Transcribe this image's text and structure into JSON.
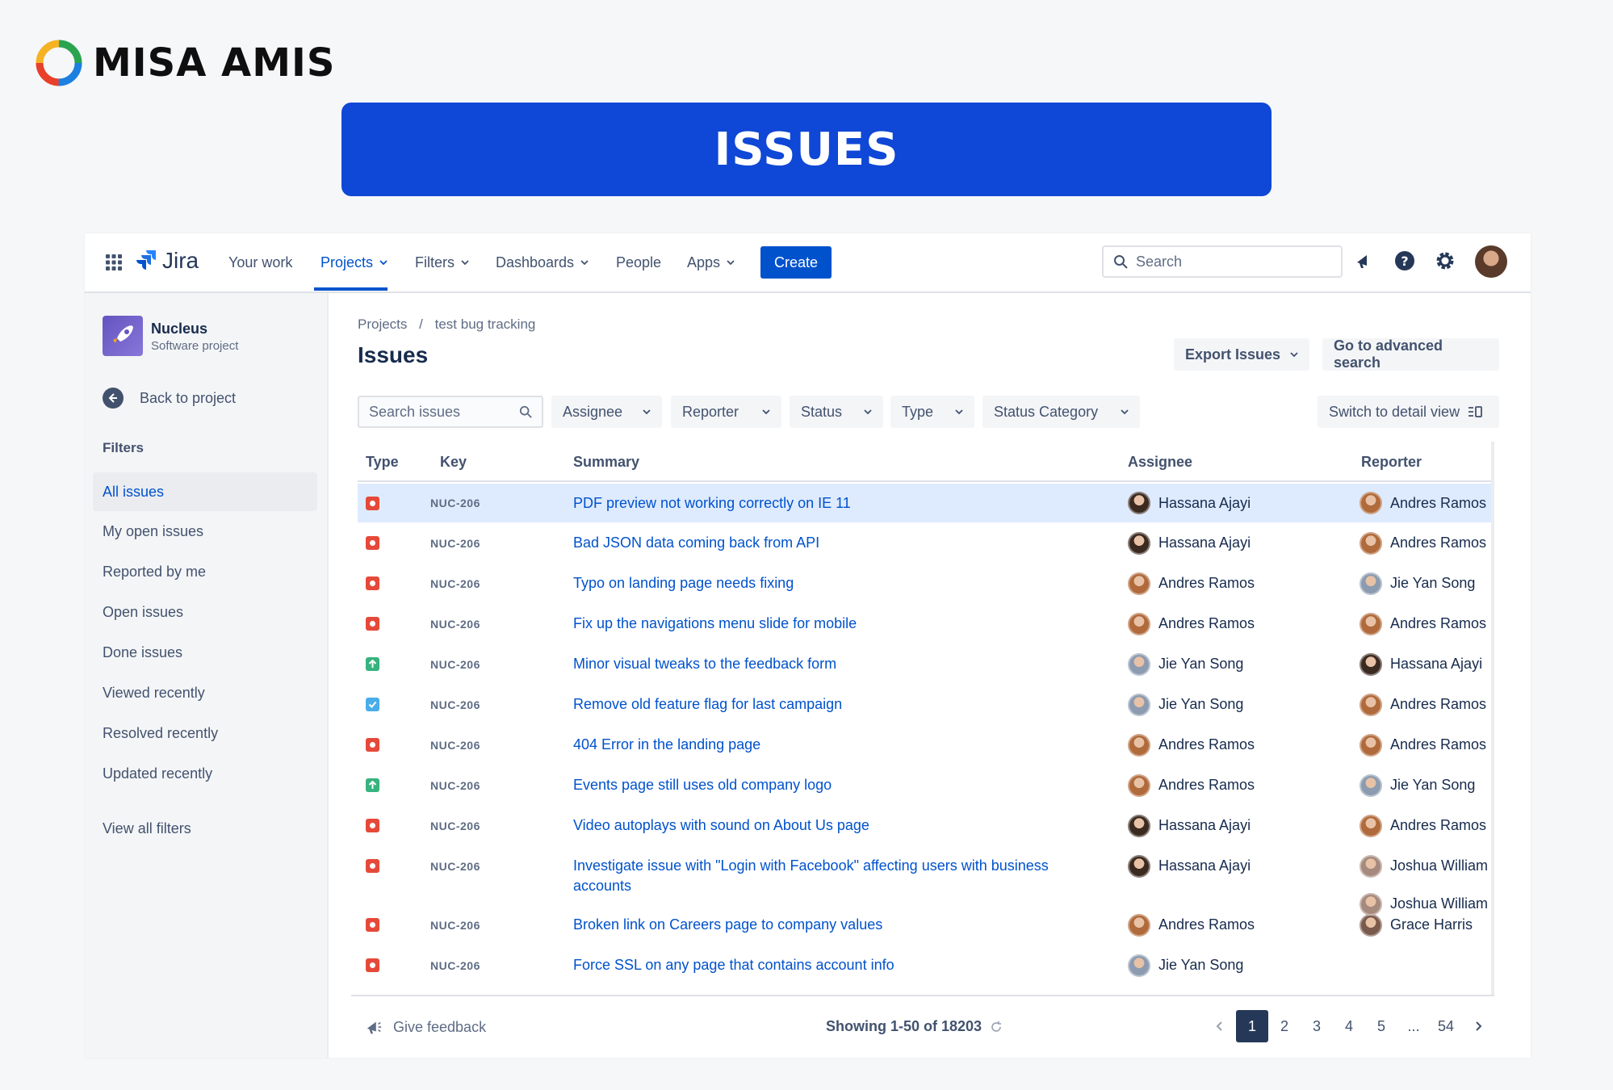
{
  "brand": {
    "name": "MISA AMIS"
  },
  "banner": {
    "title": "ISSUES"
  },
  "nav": {
    "app_name": "Jira",
    "items": [
      "Your work",
      "Projects",
      "Filters",
      "Dashboards",
      "People",
      "Apps"
    ],
    "create_label": "Create",
    "search_placeholder": "Search"
  },
  "sidebar": {
    "project_name": "Nucleus",
    "project_type": "Software project",
    "back_label": "Back to project",
    "filters_title": "Filters",
    "items": [
      "All issues",
      "My open issues",
      "Reported by me",
      "Open issues",
      "Done issues",
      "Viewed recently",
      "Resolved recently",
      "Updated recently"
    ],
    "view_all": "View all filters"
  },
  "main": {
    "breadcrumb": [
      "Projects",
      "/",
      "test bug tracking"
    ],
    "title": "Issues",
    "export_label": "Export Issues",
    "advanced_label": "Go to advanced search",
    "search_placeholder": "Search issues",
    "filters": [
      "Assignee",
      "Reporter",
      "Status",
      "Type",
      "Status Category"
    ],
    "detail_view_label": "Switch to detail view"
  },
  "table": {
    "headers": [
      "Type",
      "Key",
      "Summary",
      "Assignee",
      "Reporter"
    ],
    "rows": [
      {
        "type": "bug",
        "key": "NUC-206",
        "summary": "PDF preview not working correctly on IE 11",
        "assignee": "Hassana Ajayi",
        "reporter": "Andres Ramos"
      },
      {
        "type": "bug",
        "key": "NUC-206",
        "summary": "Bad JSON data coming back from API",
        "assignee": "Hassana Ajayi",
        "reporter": "Andres Ramos"
      },
      {
        "type": "bug",
        "key": "NUC-206",
        "summary": "Typo on landing page needs fixing",
        "assignee": "Andres Ramos",
        "reporter": "Jie Yan Song"
      },
      {
        "type": "bug",
        "key": "NUC-206",
        "summary": "Fix up the navigations menu slide for mobile",
        "assignee": "Andres Ramos",
        "reporter": "Andres Ramos"
      },
      {
        "type": "improvement",
        "key": "NUC-206",
        "summary": "Minor visual tweaks to the feedback form",
        "assignee": "Jie Yan Song",
        "reporter": "Hassana Ajayi"
      },
      {
        "type": "task",
        "key": "NUC-206",
        "summary": "Remove old feature flag for last campaign",
        "assignee": "Jie Yan Song",
        "reporter": "Andres Ramos"
      },
      {
        "type": "bug",
        "key": "NUC-206",
        "summary": "404 Error in the landing page",
        "assignee": "Andres Ramos",
        "reporter": "Andres Ramos"
      },
      {
        "type": "improvement",
        "key": "NUC-206",
        "summary": "Events page still uses old company logo",
        "assignee": "Andres Ramos",
        "reporter": "Jie Yan Song"
      },
      {
        "type": "bug",
        "key": "NUC-206",
        "summary": "Video autoplays with sound on About Us page",
        "assignee": "Hassana Ajayi",
        "reporter": "Andres Ramos"
      },
      {
        "type": "bug",
        "key": "NUC-206",
        "summary": "Investigate issue with \"Login with Facebook\" affecting users with business accounts",
        "assignee": "Hassana Ajayi",
        "reporter": "Joshua William"
      },
      {
        "type": "bug",
        "key": "NUC-206",
        "summary": "Broken link on Careers page to company values",
        "assignee": "Andres Ramos",
        "reporter": "Grace Harris"
      },
      {
        "type": "bug",
        "key": "NUC-206",
        "summary": "Force SSL on any page that contains account info",
        "assignee": "Jie Yan Song",
        "reporter": ""
      }
    ],
    "extra_reporter": "Joshua William"
  },
  "footer": {
    "feedback_label": "Give feedback",
    "showing_label": "Showing 1-50 of 18203",
    "pages": [
      "1",
      "2",
      "3",
      "4",
      "5",
      "...",
      "54"
    ],
    "current_page": "1"
  },
  "colors": {
    "brand_blue": "#0f47d6",
    "jira_blue": "#0052cc",
    "bug": "#e5493a",
    "improvement": "#36b37e",
    "task": "#4bade8",
    "selected_row": "#deebff"
  },
  "people_colors": {
    "Hassana Ajayi": "#3b2a20",
    "Andres Ramos": "#b06a3b",
    "Jie Yan Song": "#8c9bb0",
    "Joshua William": "#a68a7e",
    "Grace Harris": "#7a5a4c"
  }
}
